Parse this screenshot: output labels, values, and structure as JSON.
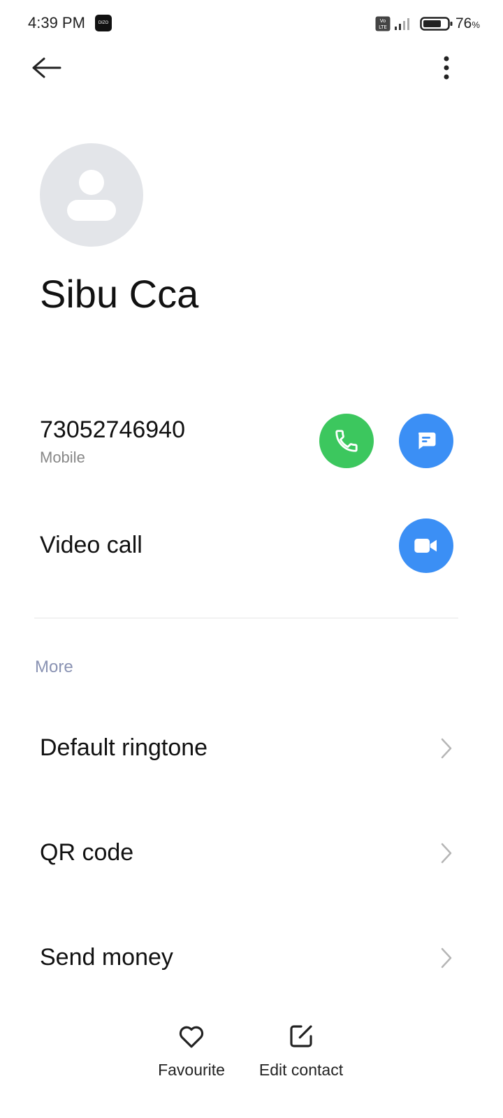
{
  "status_bar": {
    "time": "4:39 PM",
    "notification_icon": "dizo-app-icon",
    "battery_value": "76",
    "battery_unit": "%",
    "icons": [
      "volte-icon",
      "signal-icon",
      "battery-icon"
    ]
  },
  "toolbar": {
    "back_icon": "arrow-left-icon",
    "menu_icon": "more-vertical-icon"
  },
  "contact": {
    "avatar_icon": "person-placeholder-icon",
    "name": "Sibu Cca",
    "phone_number": "73052746940",
    "phone_type": "Mobile"
  },
  "actions": {
    "call_icon": "phone-icon",
    "message_icon": "message-icon",
    "video_label": "Video call",
    "video_icon": "video-camera-icon"
  },
  "more_section": {
    "header": "More",
    "items": [
      {
        "label": "Default ringtone"
      },
      {
        "label": "QR code"
      },
      {
        "label": "Send money"
      }
    ]
  },
  "bottom_bar": {
    "favourite_label": "Favourite",
    "edit_label": "Edit contact"
  },
  "colors": {
    "call_green": "#3cc75e",
    "action_blue": "#3b8ff5",
    "section_header": "#8a93b3",
    "avatar_bg": "#e3e5e9"
  }
}
